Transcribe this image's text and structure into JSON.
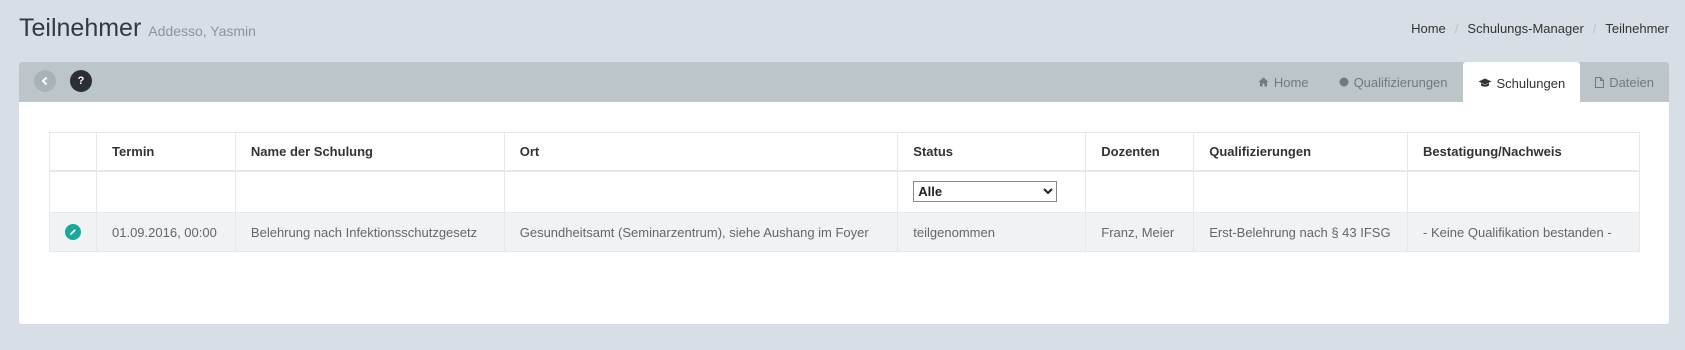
{
  "header": {
    "title": "Teilnehmer",
    "subtitle": "Addesso, Yasmin"
  },
  "breadcrumb": [
    "Home",
    "Schulungs-Manager",
    "Teilnehmer"
  ],
  "toolbar": {
    "help_label": "?"
  },
  "tabs": [
    {
      "label": "Home",
      "icon": "home-icon",
      "active": false
    },
    {
      "label": "Qualifizierungen",
      "icon": "circle-icon",
      "active": false
    },
    {
      "label": "Schulungen",
      "icon": "graduation-cap-icon",
      "active": true
    },
    {
      "label": "Dateien",
      "icon": "file-icon",
      "active": false
    }
  ],
  "table": {
    "headers": [
      "",
      "Termin",
      "Name der Schulung",
      "Ort",
      "Status",
      "Dozenten",
      "Qualifizierungen",
      "Bestatigung/Nachweis"
    ],
    "status_filter": {
      "selected": "Alle",
      "options": [
        "Alle"
      ]
    },
    "rows": [
      {
        "termin": "01.09.2016, 00:00",
        "name": "Belehrung nach Infektionsschutzgesetz",
        "ort": "Gesundheitsamt (Seminarzentrum), siehe Aushang im Foyer",
        "status": "teilgenommen",
        "dozenten": "Franz, Meier",
        "qualifizierungen": "Erst-Belehrung nach § 43 IFSG",
        "nachweis": "- Keine Qualifikation bestanden -"
      }
    ]
  },
  "colors": {
    "accent": "#1aa89c",
    "bar": "#bcc6ca",
    "background": "#d8dee6"
  }
}
